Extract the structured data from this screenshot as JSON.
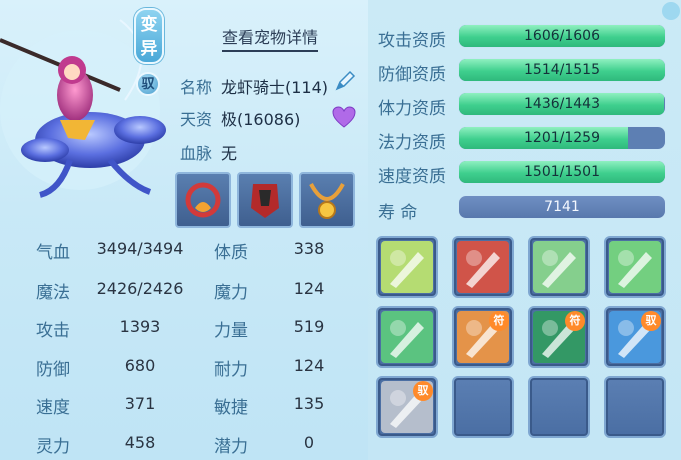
{
  "header": {
    "view_detail": "查看宠物详情"
  },
  "pet": {
    "variant_badge": "变异",
    "yu_badge": "驭",
    "name_label": "名称",
    "name_value": "龙虾骑士(114)",
    "aptitude_label": "天资",
    "aptitude_value": "极(16086)",
    "bloodline_label": "血脉",
    "bloodline_value": "无"
  },
  "equipment": [
    "collar-equip",
    "armor-equip",
    "necklace-equip"
  ],
  "stats": [
    {
      "label": "气血",
      "value": "3494/3494",
      "label2": "体质",
      "value2": "338"
    },
    {
      "label": "魔法",
      "value": "2426/2426",
      "label2": "魔力",
      "value2": "124"
    },
    {
      "label": "攻击",
      "value": "1393",
      "label2": "力量",
      "value2": "519"
    },
    {
      "label": "防御",
      "value": "680",
      "label2": "耐力",
      "value2": "124"
    },
    {
      "label": "速度",
      "value": "371",
      "label2": "敏捷",
      "value2": "135"
    },
    {
      "label": "灵力",
      "value": "458",
      "label2": "潜力",
      "value2": "0"
    }
  ],
  "aptitudes": [
    {
      "label": "攻击资质",
      "text": "1606/1606",
      "fill": 1.0
    },
    {
      "label": "防御资质",
      "text": "1514/1515",
      "fill": 0.999
    },
    {
      "label": "体力资质",
      "text": "1436/1443",
      "fill": 0.995
    },
    {
      "label": "法力资质",
      "text": "1201/1259",
      "fill": 0.82
    },
    {
      "label": "速度资质",
      "text": "1501/1501",
      "fill": 1.0
    }
  ],
  "lifespan": {
    "label": "寿  命",
    "value": "7141"
  },
  "skills": [
    {
      "icon": "sword-burst-icon",
      "tag": ""
    },
    {
      "icon": "figure-aura-icon",
      "tag": ""
    },
    {
      "icon": "sword-strike-icon",
      "tag": ""
    },
    {
      "icon": "ghost-face-icon",
      "tag": ""
    },
    {
      "icon": "spirit-gale-icon",
      "tag": ""
    },
    {
      "icon": "heart-glow-icon",
      "tag": "符"
    },
    {
      "icon": "horse-rider-icon",
      "tag": "符"
    },
    {
      "icon": "shield-icon",
      "tag": "驭"
    },
    {
      "icon": "crystal-blade-icon",
      "tag": "驭"
    },
    {
      "icon": "",
      "tag": ""
    },
    {
      "icon": "",
      "tag": ""
    },
    {
      "icon": "",
      "tag": ""
    }
  ]
}
